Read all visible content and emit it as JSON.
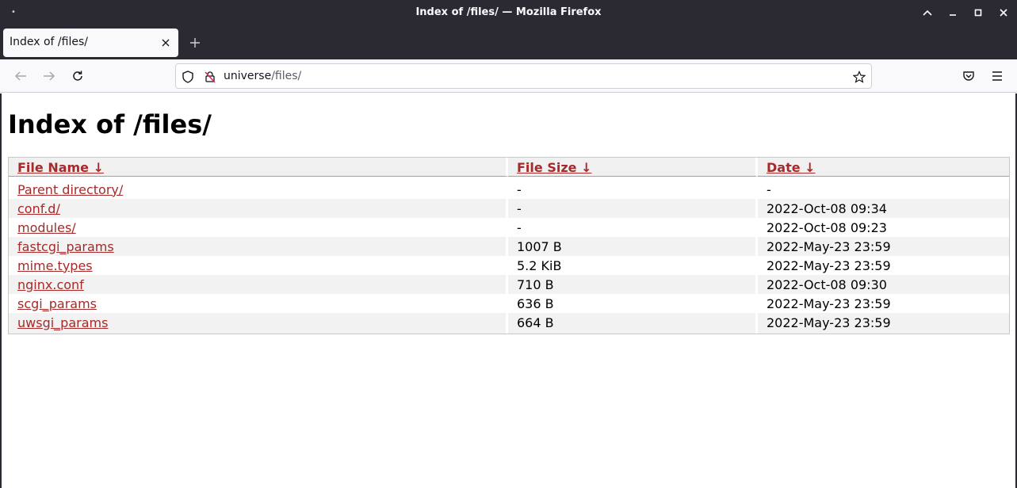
{
  "window": {
    "title": "Index of /files/ — Mozilla Firefox"
  },
  "tabs": [
    {
      "label": "Index of /files/"
    }
  ],
  "urlbar": {
    "host": "universe",
    "path": "/files/"
  },
  "page": {
    "heading": "Index of /files/",
    "columns": {
      "name": "File Name ↓",
      "size": "File Size ↓",
      "date": "Date ↓"
    },
    "rows": [
      {
        "name": "Parent directory/",
        "size": "-",
        "date": "-"
      },
      {
        "name": "conf.d/",
        "size": "-",
        "date": "2022-Oct-08 09:34"
      },
      {
        "name": "modules/",
        "size": "-",
        "date": "2022-Oct-08 09:23"
      },
      {
        "name": "fastcgi_params",
        "size": "1007 B",
        "date": "2022-May-23 23:59"
      },
      {
        "name": "mime.types",
        "size": "5.2 KiB",
        "date": "2022-May-23 23:59"
      },
      {
        "name": "nginx.conf",
        "size": "710 B",
        "date": "2022-Oct-08 09:30"
      },
      {
        "name": "scgi_params",
        "size": "636 B",
        "date": "2022-May-23 23:59"
      },
      {
        "name": "uwsgi_params",
        "size": "664 B",
        "date": "2022-May-23 23:59"
      }
    ]
  },
  "colors": {
    "link": "#a72a2a",
    "chrome_dark": "#2b2a33",
    "toolbar": "#f9f9fb"
  },
  "icons": {
    "window_menu": "window-menu-dot-icon",
    "back": "arrow-left-icon",
    "forward": "arrow-right-icon",
    "reload": "reload-icon",
    "tracking": "shield-icon",
    "insecure": "insecure-lock-icon",
    "bookmark": "star-icon",
    "pocket": "pocket-icon",
    "menu": "hamburger-menu-icon"
  }
}
